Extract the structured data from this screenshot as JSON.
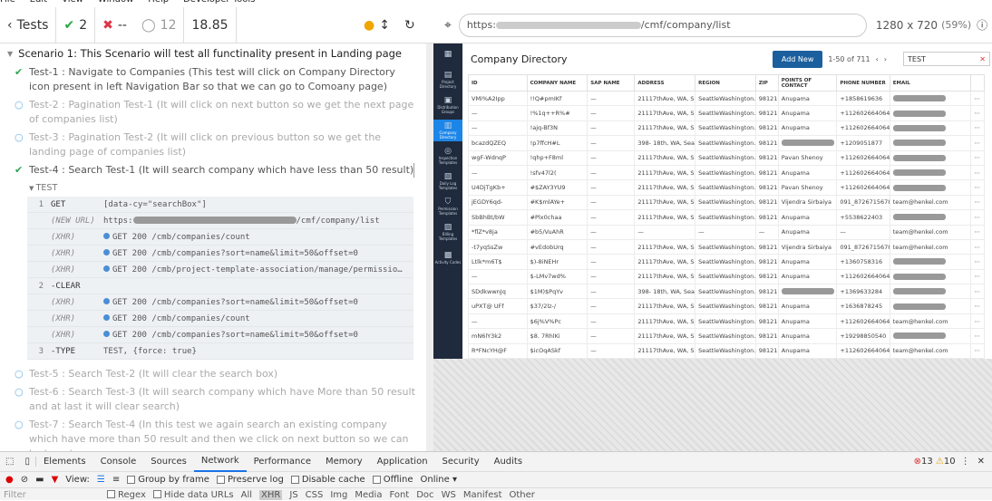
{
  "menu": [
    "File",
    "Edit",
    "View",
    "Window",
    "Help",
    "Developer Tools"
  ],
  "runner": {
    "tests_label": "Tests",
    "passed": "2",
    "failed": "--",
    "pending": "12",
    "duration": "18.85"
  },
  "scenario": "Scenario 1: This Scenario will test all functinality present in Landing page",
  "tests": [
    {
      "status": "pass",
      "text": "Test-1 : Navigate to Companies (This test will click on Company Directory icon present in left Navigation Bar so that we can go to Comoany page)"
    },
    {
      "status": "pending",
      "text": "Test-2 : Pagination Test-1 (It will click on next button so we get the next page of companies list)"
    },
    {
      "status": "pending",
      "text": "Test-3 : Pagination Test-2 (It will click on previous button so we get the landing page of companies list)"
    },
    {
      "status": "active",
      "text": "Test-4 : Search Test-1 (It will search company which have less than 50 result)"
    },
    {
      "status": "pending",
      "text": "Test-5 : Search Test-2 (It will clear the search box)"
    },
    {
      "status": "pending",
      "text": "Test-6 : Search Test-3 (It will search company which have More than 50 result and at last it will clear search)"
    },
    {
      "status": "pending",
      "text": "Test-7 : Search Test-4 (In this test we again search an existing company which have more than 50 result and then we click on next button so we can test next"
    }
  ],
  "test_block_label": "TEST",
  "commands": [
    {
      "n": "1",
      "k": "GET",
      "v": "[data-cy=\"searchBox\"]",
      "dim": false
    },
    {
      "n": "",
      "k": "(NEW URL)",
      "v": "https:",
      "v2": "/cmf/company/list",
      "dim": true
    },
    {
      "n": "",
      "k": "(XHR)",
      "v": "GET 200 /cmb/companies/count",
      "dim": true,
      "dot": true
    },
    {
      "n": "",
      "k": "(XHR)",
      "v": "GET 200 /cmb/companies?sort=name&limit=50&offset=0",
      "dim": true,
      "dot": true
    },
    {
      "n": "",
      "k": "(XHR)",
      "v": "GET 200 /cmb/project-template-association/manage/permissio…",
      "dim": true,
      "dot": true
    },
    {
      "n": "2",
      "k": "-CLEAR",
      "v": "",
      "dim": false
    },
    {
      "n": "",
      "k": "(XHR)",
      "v": "GET 200 /cmb/companies?sort=name&limit=50&offset=0",
      "dim": true,
      "dot": true
    },
    {
      "n": "",
      "k": "(XHR)",
      "v": "GET 200 /cmb/companies/count",
      "dim": true,
      "dot": true
    },
    {
      "n": "",
      "k": "(XHR)",
      "v": "GET 200 /cmb/companies?sort=name&limit=50&offset=0",
      "dim": true,
      "dot": true
    },
    {
      "n": "3",
      "k": "-TYPE",
      "v": "TEST, {force: true}",
      "dim": false
    }
  ],
  "aut": {
    "url_prefix": "https:",
    "url_suffix": "/cmf/company/list",
    "viewport": "1280 x 720",
    "zoom": "(59%)"
  },
  "app": {
    "nav": [
      {
        "icon": "▦",
        "label": ""
      },
      {
        "icon": "▤",
        "label": "Project Directory"
      },
      {
        "icon": "▣",
        "label": "Distribution Groups"
      },
      {
        "icon": "▥",
        "label": "Company Directory",
        "active": true
      },
      {
        "icon": "◎",
        "label": "Inspection Templates"
      },
      {
        "icon": "▧",
        "label": "Daily Log Templates"
      },
      {
        "icon": "⛉",
        "label": "Permission Templates"
      },
      {
        "icon": "▨",
        "label": "Billing Templates"
      },
      {
        "icon": "▩",
        "label": "Activity Codes"
      }
    ],
    "title": "Company Directory",
    "add_label": "Add New",
    "pagination": "1-50 of 711",
    "search_value": "TEST",
    "columns": [
      "ID",
      "COMPANY NAME",
      "SAP NAME",
      "ADDRESS",
      "REGION",
      "ZIP",
      "POINTS OF CONTACT",
      "PHONE NUMBER",
      "EMAIL"
    ],
    "rows": [
      [
        "VMi%A2Ipp",
        "!!Q#pmIKf",
        "—",
        "21117thAve, WA, S...",
        "SeattleWashington...",
        "98121",
        "Anupama",
        "+1858619636",
        "B"
      ],
      [
        "—",
        "!%1q++R%#",
        "—",
        "21117thAve, WA, S...",
        "SeattleWashington...",
        "98121",
        "Anupama",
        "+112602664064",
        "B"
      ],
      [
        "—",
        "!ajq-Bf3N",
        "—",
        "21117thAve, WA, S...",
        "SeattleWashington...",
        "98121",
        "Anupama",
        "+112602664064",
        "B"
      ],
      [
        "bcazdQZEQ",
        "!p7ffcH#L",
        "—",
        "398- 18th, WA, Sea...",
        "SeattleWashington...",
        "98121",
        "B",
        "+1209051877",
        "B"
      ],
      [
        "wgF-WdnqP",
        "!qhp+F8ml",
        "—",
        "21117thAve, WA, S...",
        "SeattleWashington...",
        "98121",
        "Pavan Shenoy",
        "+112602664064",
        "B"
      ],
      [
        "—",
        "!sfv47l2(",
        "—",
        "21117thAve, WA, S...",
        "SeattleWashington...",
        "98121",
        "Anupama",
        "+112602664064",
        "B"
      ],
      [
        "U4DjTgKb+",
        "#$ZAY3YU9",
        "—",
        "21117thAve, WA, S...",
        "SeattleWashington...",
        "98121",
        "Pavan Shenoy",
        "+112602664064",
        "B"
      ],
      [
        "jEGDY6qd-",
        "#K$mlAYe+",
        "—",
        "21117thAve, WA, S...",
        "SeattleWashington...",
        "98121",
        "Vijendra Sirbaiya",
        "091_8726715678",
        "team@henkel.com"
      ],
      [
        "SbBhBt/bW",
        "#Plx0chaa",
        "—",
        "21117thAve, WA, S...",
        "SeattleWashington...",
        "98121",
        "Anupama",
        "+5538622403",
        "B"
      ],
      [
        "*flZ*v8ja",
        "#b5/VuAhR",
        "—",
        "—",
        "—",
        "—",
        "Anupama",
        "—",
        "team@henkel.com"
      ],
      [
        "-t7yqSsZw",
        "#vEdobUrq",
        "—",
        "21117thAve, WA, S...",
        "SeattleWashington...",
        "98121",
        "Vijendra Sirbaiya",
        "091_8726715678",
        "team@henkel.com"
      ],
      [
        "Ltlk*m6T$",
        "$)-8iNEHr",
        "—",
        "21117thAve, WA, S...",
        "SeattleWashington...",
        "98121",
        "Anupama",
        "+1360758316",
        "B"
      ],
      [
        "—",
        "$-LMv7wd%",
        "—",
        "21117thAve, WA, S...",
        "SeattleWashington...",
        "98121",
        "Anupama",
        "+112602664064",
        "B"
      ],
      [
        "SDdkwwnJq",
        "$1M)$PqYv",
        "—",
        "398- 18th, WA, Sea...",
        "SeattleWashington...",
        "98121",
        "B",
        "+1369633284",
        "B"
      ],
      [
        "uPXT@ UFf",
        "$37/2lz-/",
        "—",
        "21117thAve, WA, S...",
        "SeattleWashington...",
        "98121",
        "Anupama",
        "+1636878245",
        "B"
      ],
      [
        "—",
        "$6j%V%Pc",
        "—",
        "21117thAve, WA, S...",
        "SeattleWashington...",
        "98121",
        "Anupama",
        "+112602664064",
        "team@henkel.com"
      ],
      [
        "mN6lY3k2",
        "$8. 7RhlKi",
        "—",
        "21117thAve, WA, S...",
        "SeattleWashington...",
        "98121",
        "Anupama",
        "+19298850540",
        "B"
      ],
      [
        "R*FNcYH@F",
        "$icOqASkf",
        "—",
        "21117thAve, WA, S...",
        "SeattleWashington...",
        "98121",
        "Anupama",
        "+112602664064",
        "team@henkel.com"
      ]
    ]
  },
  "devtools": {
    "tabs": [
      "Elements",
      "Console",
      "Sources",
      "Network",
      "Performance",
      "Memory",
      "Application",
      "Security",
      "Audits"
    ],
    "active_tab": "Network",
    "errors": "13",
    "warnings": "10",
    "view_label": "View:",
    "group_label": "Group by frame",
    "preserve_label": "Preserve log",
    "disable_cache_label": "Disable cache",
    "offline_label": "Offline",
    "online_label": "Online",
    "filter_placeholder": "Filter",
    "regex_label": "Regex",
    "hide_data_label": "Hide data URLs",
    "all_label": "All",
    "types": [
      "XHR",
      "JS",
      "CSS",
      "Img",
      "Media",
      "Font",
      "Doc",
      "WS",
      "Manifest",
      "Other"
    ]
  }
}
